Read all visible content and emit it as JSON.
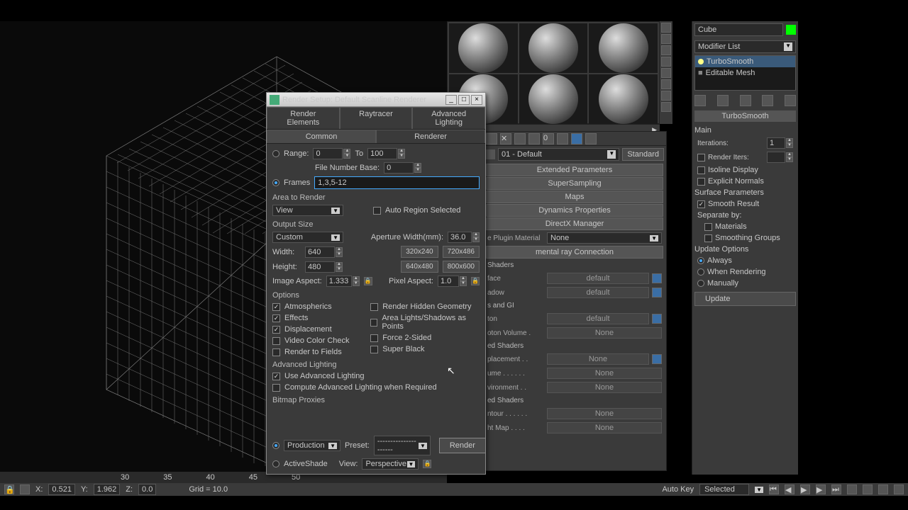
{
  "ruler": [
    "30",
    "35",
    "40",
    "45",
    "50"
  ],
  "status": {
    "x_lbl": "X:",
    "x": "0.521",
    "y_lbl": "Y:",
    "y": "1.962",
    "z_lbl": "Z:",
    "z": "0.0",
    "grid": "Grid = 10.0",
    "autokey": "Auto Key",
    "selected": "Selected"
  },
  "dialog": {
    "title": "Render Setup: Default Scanline Renderer",
    "tabs_top": [
      "Render Elements",
      "Raytracer",
      "Advanced Lighting"
    ],
    "tabs_bot": [
      "Common",
      "Renderer"
    ],
    "range_lbl": "Range:",
    "range_from": "0",
    "to": "To",
    "range_to": "100",
    "filebase_lbl": "File Number Base:",
    "filebase": "0",
    "frames_lbl": "Frames",
    "frames": "1,3,5-12",
    "area_lbl": "Area to Render",
    "area_val": "View",
    "auto_region": "Auto Region Selected",
    "output_lbl": "Output Size",
    "output_val": "Custom",
    "aperture_lbl": "Aperture Width(mm):",
    "aperture": "36.0",
    "width_lbl": "Width:",
    "width": "640",
    "height_lbl": "Height:",
    "height": "480",
    "presets": [
      "320x240",
      "720x486",
      "640x480",
      "800x600"
    ],
    "imgaspect_lbl": "Image Aspect:",
    "imgaspect": "1.333",
    "pixaspect_lbl": "Pixel Aspect:",
    "pixaspect": "1.0",
    "options_lbl": "Options",
    "opts_left": [
      "Atmospherics",
      "Effects",
      "Displacement",
      "Video Color Check",
      "Render to Fields"
    ],
    "opts_left_chk": [
      true,
      true,
      true,
      false,
      false
    ],
    "opts_right": [
      "Render Hidden Geometry",
      "Area Lights/Shadows as Points",
      "Force 2-Sided",
      "Super Black"
    ],
    "opts_right_chk": [
      false,
      false,
      false,
      false
    ],
    "advlight_lbl": "Advanced Lighting",
    "advlight_use": "Use Advanced Lighting",
    "advlight_comp": "Compute Advanced Lighting when Required",
    "bitmap_lbl": "Bitmap Proxies",
    "production": "Production",
    "activeshade": "ActiveShade",
    "preset_lbl": "Preset:",
    "preset_val": "---------------------",
    "view_lbl": "View:",
    "view_val": "Perspective",
    "render_btn": "Render"
  },
  "mat": {
    "name": "01 - Default",
    "type": "Standard",
    "rollouts": [
      "Extended Parameters",
      "SuperSampling",
      "Maps",
      "Dynamics Properties",
      "DirectX Manager"
    ],
    "plugin_lbl": "e Plugin Material",
    "plugin_val": "None",
    "mr_title": "mental ray Connection",
    "sec1": "Shaders",
    "sec2": "s and GI",
    "sec3": "ed Shaders",
    "sec4": "ed Shaders",
    "rows1": [
      {
        "l": "face",
        "v": "default"
      },
      {
        "l": "adow",
        "v": "default"
      }
    ],
    "rows2": [
      {
        "l": "ton",
        "v": "default"
      },
      {
        "l": "oton Volume .",
        "v": "None"
      }
    ],
    "rows3": [
      {
        "l": "placement . .",
        "v": "None"
      },
      {
        "l": "ume . . . . . .",
        "v": "None"
      },
      {
        "l": "vironment . .",
        "v": "None"
      }
    ],
    "rows4": [
      {
        "l": "ntour . . . . . .",
        "v": "None"
      },
      {
        "l": "ht Map . . . .",
        "v": "None"
      }
    ]
  },
  "mod": {
    "obj": "Cube",
    "list": "Modifier List",
    "stack": [
      "TurboSmooth",
      "Editable Mesh"
    ],
    "ts_name": "TurboSmooth",
    "main": "Main",
    "iter_lbl": "Iterations:",
    "iter": "1",
    "renderiter_lbl": "Render Iters:",
    "renderiter": "",
    "isoline": "Isoline Display",
    "explicit": "Explicit Normals",
    "surf_lbl": "Surface Parameters",
    "smooth_result": "Smooth Result",
    "sep_lbl": "Separate by:",
    "sep_mat": "Materials",
    "sep_sg": "Smoothing Groups",
    "upd_lbl": "Update Options",
    "upd_always": "Always",
    "upd_render": "When Rendering",
    "upd_manual": "Manually",
    "upd_btn": "Update"
  }
}
